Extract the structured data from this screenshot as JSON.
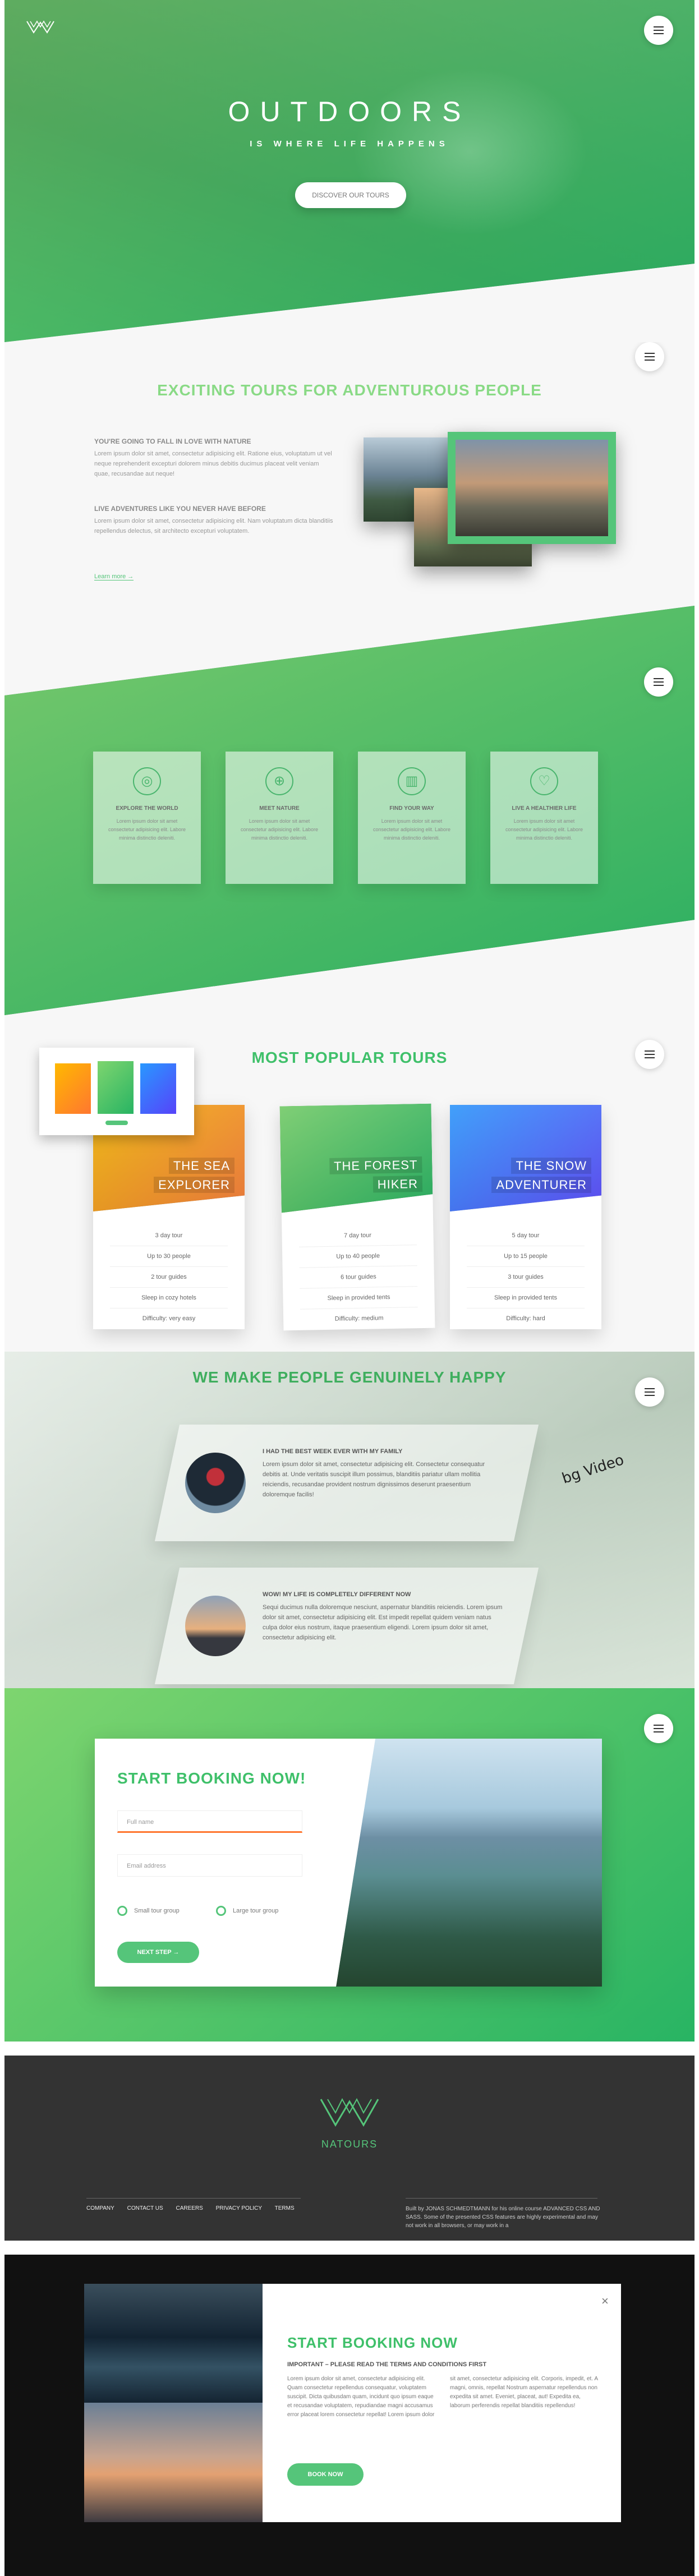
{
  "hero": {
    "title": "OUTDOORS",
    "subtitle": "IS WHERE LIFE HAPPENS",
    "cta": "DISCOVER OUR TOURS"
  },
  "about": {
    "heading": "EXCITING TOURS FOR ADVENTUROUS PEOPLE",
    "h3_1": "YOU'RE GOING TO FALL IN LOVE WITH NATURE",
    "p1": "Lorem ipsum dolor sit amet, consectetur adipisicing elit. Ratione eius, voluptatum ut vel neque reprehenderit excepturi dolorem minus debitis ducimus placeat velit veniam quae, recusandae aut neque!",
    "h3_2": "LIVE ADVENTURES LIKE YOU NEVER HAVE BEFORE",
    "p2": "Lorem ipsum dolor sit amet, consectetur adipisicing elit. Nam voluptatum dicta blanditiis repellendus delectus, sit architecto excepturi voluptatem.",
    "link": "Learn more →"
  },
  "features": [
    {
      "icon": "globe-icon",
      "glyph": "◎",
      "title": "EXPLORE THE WORLD",
      "text": "Lorem ipsum dolor sit amet consectetur adipisicing elit. Labore minima distinctio deleniti."
    },
    {
      "icon": "compass-icon",
      "glyph": "⊕",
      "title": "MEET NATURE",
      "text": "Lorem ipsum dolor sit amet consectetur adipisicing elit. Labore minima distinctio deleniti."
    },
    {
      "icon": "map-icon",
      "glyph": "▥",
      "title": "FIND YOUR WAY",
      "text": "Lorem ipsum dolor sit amet consectetur adipisicing elit. Labore minima distinctio deleniti."
    },
    {
      "icon": "heart-icon",
      "glyph": "♡",
      "title": "LIVE A HEALTHIER LIFE",
      "text": "Lorem ipsum dolor sit amet consectetur adipisicing elit. Labore minima distinctio deleniti."
    }
  ],
  "tours": {
    "heading": "MOST POPULAR TOURS",
    "cards": [
      {
        "name1": "THE SEA",
        "name2": "EXPLORER",
        "items": [
          "3 day tour",
          "Up to 30 people",
          "2 tour guides",
          "Sleep in cozy hotels",
          "Difficulty: very easy"
        ]
      },
      {
        "name1": "THE FOREST",
        "name2": "HIKER",
        "items": [
          "7 day tour",
          "Up to 40 people",
          "6 tour guides",
          "Sleep in provided tents",
          "Difficulty: medium"
        ]
      },
      {
        "name1": "THE SNOW",
        "name2": "ADVENTURER",
        "items": [
          "5 day tour",
          "Up to 15 people",
          "3 tour guides",
          "Sleep in provided tents",
          "Difficulty: hard"
        ]
      }
    ]
  },
  "stories": {
    "heading": "WE MAKE PEOPLE GENUINELY HAPPY",
    "scribble": "bg Video",
    "items": [
      {
        "title": "I HAD THE BEST WEEK EVER WITH MY FAMILY",
        "text": "Lorem ipsum dolor sit amet, consectetur adipisicing elit. Consectetur consequatur debitis at. Unde veritatis suscipit illum possimus, blanditiis pariatur ullam mollitia reiciendis, recusandae provident nostrum dignissimos deserunt praesentium doloremque facilis!"
      },
      {
        "title": "WOW! MY LIFE IS COMPLETELY DIFFERENT NOW",
        "text": "Sequi ducimus nulla doloremque nesciunt, aspernatur blanditiis reiciendis. Lorem ipsum dolor sit amet, consectetur adipisicing elit. Est impedit repellat quidem veniam natus culpa dolor eius nostrum, itaque praesentium eligendi. Lorem ipsum dolor sit amet, consectetur adipisicing elit."
      }
    ]
  },
  "booking": {
    "heading": "START BOOKING NOW!",
    "name_placeholder": "Full name",
    "email_placeholder": "Email address",
    "radio1": "Small tour group",
    "radio2": "Large tour group",
    "next": "NEXT STEP →"
  },
  "footer": {
    "brand": "NATOURS",
    "nav": [
      "COMPANY",
      "CONTACT US",
      "CAREERS",
      "PRIVACY POLICY",
      "TERMS"
    ],
    "copyright": "Built by JONAS SCHMEDTMANN for his online course ADVANCED CSS AND SASS. Some of the presented CSS features are highly experimental and may not work in all browsers, or may work in a"
  },
  "popup": {
    "heading": "START BOOKING NOW",
    "subheading": "IMPORTANT – PLEASE READ THE TERMS AND CONDITIONS FIRST",
    "text": "Lorem ipsum dolor sit amet, consectetur adipisicing elit. Quam consectetur repellendus consequatur, voluptatem suscipit. Dicta quibusdam quam, incidunt quo ipsum eaque et recusandae voluptatem, repudiandae magni accusamus error placeat lorem consectetur repellat! Lorem ipsum dolor sit amet, consectetur adipisicing elit. Corporis, impedit, et. A magni, omnis, repellat Nostrum aspernatur repellendus non expedita sit amet. Eveniet, placeat, aut! Expedita ea, laborum perferendis repellat blanditiis repellendus!",
    "button": "BOOK NOW",
    "close": "×"
  },
  "colors": {
    "primary": "#55c57a",
    "primary_light": "#7ed56f",
    "primary_dark": "#28b463",
    "footer_bg": "#333333"
  }
}
